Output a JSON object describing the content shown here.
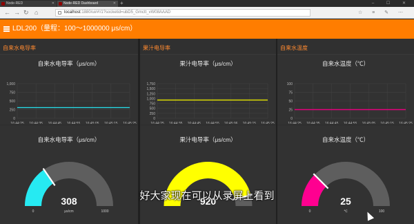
{
  "browser": {
    "tabs": [
      {
        "label": "Node-RED",
        "active": false
      },
      {
        "label": "Node-RED Dashboard",
        "active": true
      }
    ],
    "new_tab": "+",
    "window_controls": "– ☐ ✕",
    "url_host": "localhost",
    "url_path": ":1880/ui/#!/1?socketid=ubD5_Gmctt_vW08AAAD"
  },
  "header": {
    "title": "LDL200（量程：100～1000000 μs/cm）"
  },
  "groups": [
    {
      "title": "自来水电导率"
    },
    {
      "title": "果汁电导率"
    },
    {
      "title": "自来水温度"
    }
  ],
  "chart_data": [
    {
      "type": "line",
      "title": "自来水电导率（μs/cm）",
      "x": [
        "16:44:25",
        "16:44:35",
        "16:44:45",
        "16:44:55",
        "16:45:05",
        "16:45:15",
        "16:45:25"
      ],
      "y_ticks": [
        "1,000",
        "750",
        "500",
        "250",
        "0"
      ],
      "ylim": [
        0,
        1000
      ],
      "series": [
        {
          "values": [
            308,
            308,
            308,
            308,
            308,
            308,
            308
          ],
          "color": "#26d9e6"
        }
      ]
    },
    {
      "type": "line",
      "title": "果汁电导率（μs/cm）",
      "x": [
        "16:44:25",
        "16:44:35",
        "16:44:45",
        "16:44:55",
        "16:45:06",
        "16:45:15",
        "16:45:25"
      ],
      "y_ticks": [
        "1,750",
        "1,500",
        "1,250",
        "1,000",
        "750",
        "500",
        "250",
        "0"
      ],
      "ylim": [
        0,
        1750
      ],
      "series": [
        {
          "values": [
            920,
            920,
            920,
            920,
            920,
            920,
            920
          ],
          "color": "#e6e600"
        }
      ]
    },
    {
      "type": "line",
      "title": "自来水温度（℃）",
      "x": [
        "16:44:25",
        "16:44:35",
        "16:44:45",
        "16:44:55",
        "16:45:05",
        "16:45:15",
        "16:45:25"
      ],
      "y_ticks": [
        "100",
        "75",
        "50",
        "25",
        "0"
      ],
      "ylim": [
        0,
        100
      ],
      "series": [
        {
          "values": [
            25,
            25,
            25,
            25,
            25,
            25,
            25
          ],
          "color": "#e6007e"
        }
      ]
    }
  ],
  "gauges": [
    {
      "title": "自来水电导率（μs/cm）",
      "value": 308,
      "value_text": "308",
      "min": 0,
      "min_text": "0",
      "max": 1000,
      "max_text": "1000",
      "unit": "μs/cm",
      "color": "#26eaf2"
    },
    {
      "title": "果汁电导率（μs/cm）",
      "value": 920,
      "value_text": "920",
      "min": 0,
      "min_text": "",
      "max": 1000,
      "max_text": "",
      "unit": "",
      "color": "#ffff00"
    },
    {
      "title": "自来水温度（℃）",
      "value": 25,
      "value_text": "25",
      "min": 0,
      "min_text": "0",
      "max": 100,
      "max_text": "100",
      "unit": "℃",
      "color": "#ff0090"
    }
  ],
  "subtitle": "好大家现在可以从录屏上看到",
  "colors": {
    "accent": "#ff7d00",
    "background": "#202020",
    "card": "#303030"
  }
}
